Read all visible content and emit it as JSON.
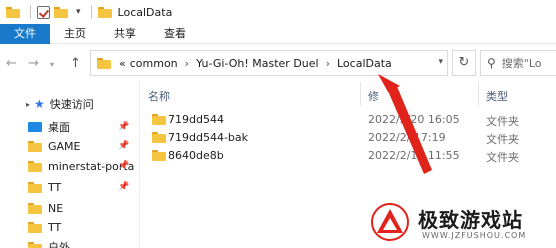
{
  "window": {
    "title": "LocalData"
  },
  "ribbon": {
    "tabs": [
      {
        "label": "文件"
      },
      {
        "label": "主页"
      },
      {
        "label": "共享"
      },
      {
        "label": "查看"
      }
    ]
  },
  "address": {
    "overflow": "«",
    "crumbs": [
      "common",
      "Yu-Gi-Oh!  Master Duel",
      "LocalData"
    ]
  },
  "search": {
    "placeholder": "搜索\"Lo"
  },
  "sidebar": {
    "quick_access": "快速访问",
    "items": [
      {
        "label": "桌面",
        "pinned": true
      },
      {
        "label": "GAME",
        "pinned": true
      },
      {
        "label": "minerstat-porta",
        "pinned": true
      },
      {
        "label": "TT",
        "pinned": true
      },
      {
        "label": "NE",
        "pinned": false
      },
      {
        "label": "TT",
        "pinned": false
      },
      {
        "label": "户外",
        "pinned": false
      }
    ]
  },
  "columns": {
    "name": "名称",
    "date": "修",
    "type": "类型"
  },
  "files": [
    {
      "name": "719dd544",
      "date": "2022/2/20 16:05",
      "type": "文件夹"
    },
    {
      "name": "719dd544-bak",
      "date": "2022/2/  17:19",
      "type": "文件夹"
    },
    {
      "name": "8640de8b",
      "date": "2022/2/19 11:55",
      "type": "文件夹"
    }
  ],
  "watermark": {
    "name": "极致游戏站",
    "url": "WWW.JZFUSHOU.COM"
  },
  "colors": {
    "accent": "#1979ca",
    "annotation": "#e0241b",
    "folder": "#f5c542"
  }
}
